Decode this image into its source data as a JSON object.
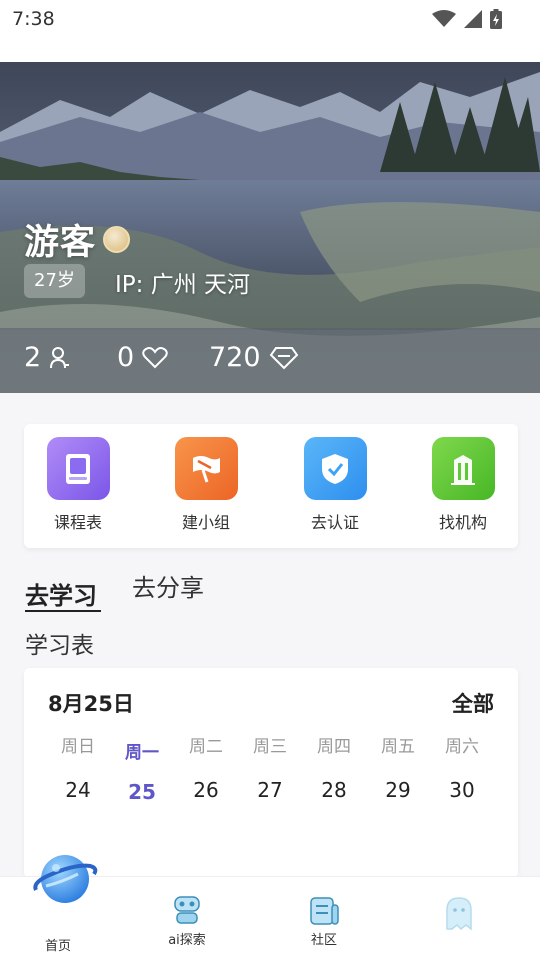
{
  "status_bar": {
    "time": "7:38"
  },
  "profile": {
    "name": "游客",
    "age": "27岁",
    "ip": "IP: 广州 天河",
    "stats": {
      "following": "2",
      "likes": "0",
      "diamonds": "720"
    }
  },
  "quick_actions": [
    {
      "label": "课程表",
      "icon": "book-icon",
      "color": "#8b6cf0"
    },
    {
      "label": "建小组",
      "icon": "flag-icon",
      "color": "#f07a3a"
    },
    {
      "label": "去认证",
      "icon": "shield-check-icon",
      "color": "#3fa3f5"
    },
    {
      "label": "找机构",
      "icon": "building-icon",
      "color": "#5ec83a"
    }
  ],
  "tabs": {
    "active": "去学习",
    "inactive": "去分享"
  },
  "section_title": "学习表",
  "calendar": {
    "date": "8月25日",
    "all_label": "全部",
    "weekdays": [
      "周日",
      "周一",
      "周二",
      "周三",
      "周四",
      "周五",
      "周六"
    ],
    "days": [
      "24",
      "25",
      "26",
      "27",
      "28",
      "29",
      "30"
    ],
    "selected_index": 1,
    "accent": "#5f57c9"
  },
  "bottom_nav": [
    {
      "label": "首页",
      "icon": "planet-icon"
    },
    {
      "label": "ai探索",
      "icon": "robot-icon"
    },
    {
      "label": "社区",
      "icon": "newspaper-icon"
    },
    {
      "label": "",
      "icon": "ghost-icon"
    }
  ]
}
